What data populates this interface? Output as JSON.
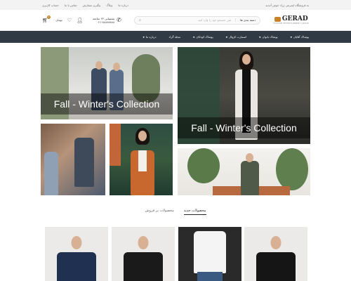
{
  "topbar": {
    "announcement": "به فروشگاه اینترنتی ژراد خوش آمدید",
    "links": [
      "درباره ما",
      "وبلاگ",
      "پیگیری سفارش",
      "تماس با ما",
      "حساب کاربری"
    ]
  },
  "header": {
    "logo_text": "GERAD",
    "logo_sub": "FASHION ENTERTAINMENT GROUP",
    "search_category": "دسته بندی ها",
    "search_placeholder": "متن جستجو خود را وارد کنید",
    "phone_label": "پشتیبانی ۲۴ ساعته",
    "phone_number": "۰۲۱-۸۸۸۸۸۸۸۸",
    "cart_count": "0",
    "cart_price": "۰ تومان"
  },
  "nav": {
    "items": [
      {
        "label": "پوشاک آقایان",
        "has_dropdown": true
      },
      {
        "label": "پوشاک بانوان",
        "has_dropdown": true
      },
      {
        "label": "اسمارت کژوال",
        "has_dropdown": true
      },
      {
        "label": "پوشاک کودکان",
        "has_dropdown": true
      },
      {
        "label": "مجله گراد",
        "has_dropdown": false
      },
      {
        "label": "درباره ما",
        "has_dropdown": true
      }
    ]
  },
  "banners": {
    "top_left_caption": "Fall - Winter's Collection",
    "right_caption": "Fall - Winter's Collection"
  },
  "tabs": {
    "new_products": "محصولات جدید",
    "best_sellers": "محصولات پر فروش"
  },
  "colors": {
    "accent": "#c8842a",
    "nav_bg": "#2f3a44"
  },
  "icons": {
    "search": "search-icon",
    "phone": "phone-icon",
    "user": "user-icon",
    "heart": "heart-icon",
    "cart": "cart-icon"
  }
}
